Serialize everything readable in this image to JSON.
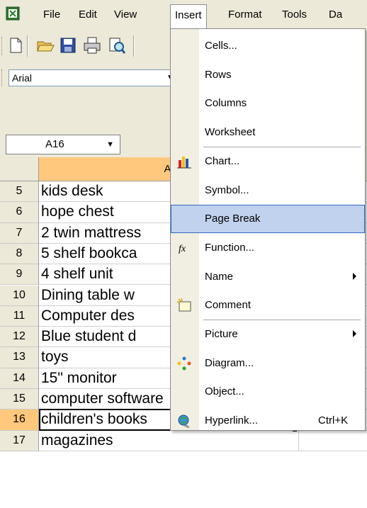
{
  "menubar": {
    "items": [
      "File",
      "Edit",
      "View",
      "Insert",
      "Format",
      "Tools",
      "Da"
    ]
  },
  "toolbar": {
    "font_name": "Arial"
  },
  "namebox": {
    "value": "A16"
  },
  "grid": {
    "column_header": "A",
    "rows": [
      {
        "num": "5",
        "value": "kids desk"
      },
      {
        "num": "6",
        "value": "hope chest"
      },
      {
        "num": "7",
        "value": "2 twin mattress"
      },
      {
        "num": "8",
        "value": "5 shelf bookca"
      },
      {
        "num": "9",
        "value": "4 shelf unit"
      },
      {
        "num": "10",
        "value": "Dining table w"
      },
      {
        "num": "11",
        "value": "Computer des"
      },
      {
        "num": "12",
        "value": "Blue student d"
      },
      {
        "num": "13",
        "value": "toys"
      },
      {
        "num": "14",
        "value": "15\" monitor"
      },
      {
        "num": "15",
        "value": "computer software"
      },
      {
        "num": "16",
        "value": "children's books"
      },
      {
        "num": "17",
        "value": "magazines"
      }
    ],
    "selected_row": "16"
  },
  "insert_menu": {
    "items": [
      {
        "label": "Cells...",
        "icon": "",
        "submenu": false,
        "shortcut": ""
      },
      {
        "label": "Rows",
        "icon": "",
        "submenu": false,
        "shortcut": ""
      },
      {
        "label": "Columns",
        "icon": "",
        "submenu": false,
        "shortcut": ""
      },
      {
        "label": "Worksheet",
        "icon": "",
        "submenu": false,
        "shortcut": ""
      },
      {
        "label": "Chart...",
        "icon": "chart-icon",
        "submenu": false,
        "shortcut": ""
      },
      {
        "label": "Symbol...",
        "icon": "",
        "submenu": false,
        "shortcut": ""
      },
      {
        "label": "Page Break",
        "icon": "",
        "submenu": false,
        "shortcut": "",
        "highlighted": true
      },
      {
        "label": "Function...",
        "icon": "function-icon",
        "submenu": false,
        "shortcut": ""
      },
      {
        "label": "Name",
        "icon": "",
        "submenu": true,
        "shortcut": ""
      },
      {
        "label": "Comment",
        "icon": "comment-icon",
        "submenu": false,
        "shortcut": ""
      },
      {
        "label": "Picture",
        "icon": "",
        "submenu": true,
        "shortcut": ""
      },
      {
        "label": "Diagram...",
        "icon": "diagram-icon",
        "submenu": false,
        "shortcut": ""
      },
      {
        "label": "Object...",
        "icon": "",
        "submenu": false,
        "shortcut": ""
      },
      {
        "label": "Hyperlink...",
        "icon": "hyperlink-icon",
        "submenu": false,
        "shortcut": "Ctrl+K"
      }
    ]
  },
  "colors": {
    "highlight": "#c1d2ee",
    "selected_header": "#ffc87c"
  }
}
